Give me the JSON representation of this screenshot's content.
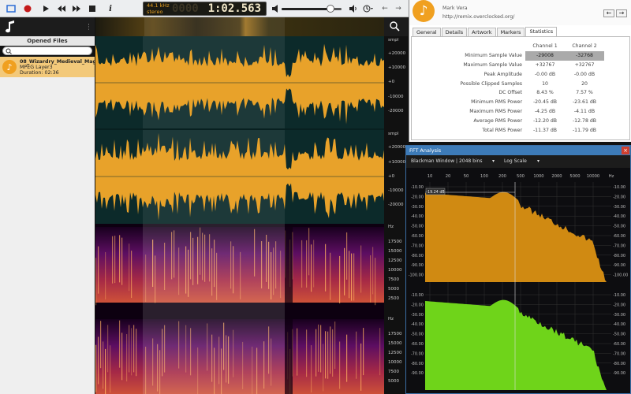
{
  "toolbar": {
    "buttons": [
      "select-tool",
      "record",
      "play",
      "rewind",
      "fast-forward",
      "stop",
      "info"
    ],
    "sample_rate": "44.1 kHz",
    "channels_mode": "stereo",
    "time_ghost": "0000",
    "time": "1:02.563",
    "volume": 0.82
  },
  "sidebar": {
    "title": "Opened Files",
    "search_placeholder": "",
    "file": {
      "name": "08_Wizardry_Medieval_Magic...",
      "format": "MPEG Layer3",
      "duration": "Duration: 02:36"
    }
  },
  "axes": {
    "wave_unit": "smpl",
    "wave_ticks": [
      "+20000",
      "+10000",
      "+0",
      "-10000",
      "-20000"
    ],
    "spec_unit": "Hz",
    "spec_ticks": [
      "17500",
      "15000",
      "12500",
      "10000",
      "7500",
      "5000",
      "2500"
    ]
  },
  "info": {
    "artist": "Mark Vera",
    "url": "http://remix.overclocked.org/",
    "tabs": [
      "General",
      "Details",
      "Artwork",
      "Markers",
      "Statistics"
    ],
    "active_tab": "Statistics",
    "columns": [
      "Channel 1",
      "Channel 2"
    ],
    "rows": [
      {
        "label": "Minimum Sample Value",
        "c1": "-29008",
        "c2": "-32768"
      },
      {
        "label": "Maximum Sample Value",
        "c1": "+32767",
        "c2": "+32767"
      },
      {
        "label": "Peak Amplitude",
        "c1": "-0.00 dB",
        "c2": "-0.00 dB"
      },
      {
        "label": "Possible Clipped Samples",
        "c1": "10",
        "c2": "20"
      },
      {
        "label": "DC Offset",
        "c1": "8.43 %",
        "c2": "7.57 %"
      },
      {
        "label": "Minimum RMS Power",
        "c1": "-20.45 dB",
        "c2": "-23.61 dB"
      },
      {
        "label": "Maximum RMS Power",
        "c1": "-4.25 dB",
        "c2": "-4.11 dB"
      },
      {
        "label": "Average RMS Power",
        "c1": "-12.20 dB",
        "c2": "-12.78 dB"
      },
      {
        "label": "Total RMS Power",
        "c1": "-11.37 dB",
        "c2": "-11.79 dB"
      }
    ]
  },
  "fft": {
    "title": "FFT Analysis",
    "window": "Blackman Window | 2048 bins",
    "scale": "Log Scale",
    "cursor_readout": "-19.24 dB",
    "freq_ticks": [
      "10",
      "20",
      "50",
      "100",
      "200",
      "500",
      "1000",
      "2000",
      "5000",
      "10000",
      "Hz"
    ],
    "db_ticks_top": [
      "-10.00",
      "-20.00",
      "-30.00",
      "-40.00",
      "-50.00",
      "-60.00",
      "-70.00",
      "-80.00",
      "-90.00",
      "-100.00"
    ],
    "db_ticks_bottom": [
      "-10.00",
      "-20.00",
      "-30.00",
      "-40.00",
      "-50.00",
      "-60.00",
      "-70.00",
      "-80.00",
      "-90.00"
    ],
    "colors": {
      "ch1": "#d08a12",
      "ch2": "#6fd41a",
      "bg": "#0d0d10"
    }
  },
  "colors": {
    "waveform": "#e8a22a",
    "wave_bg": "#0c2a2a",
    "accent": "#f0a020"
  }
}
